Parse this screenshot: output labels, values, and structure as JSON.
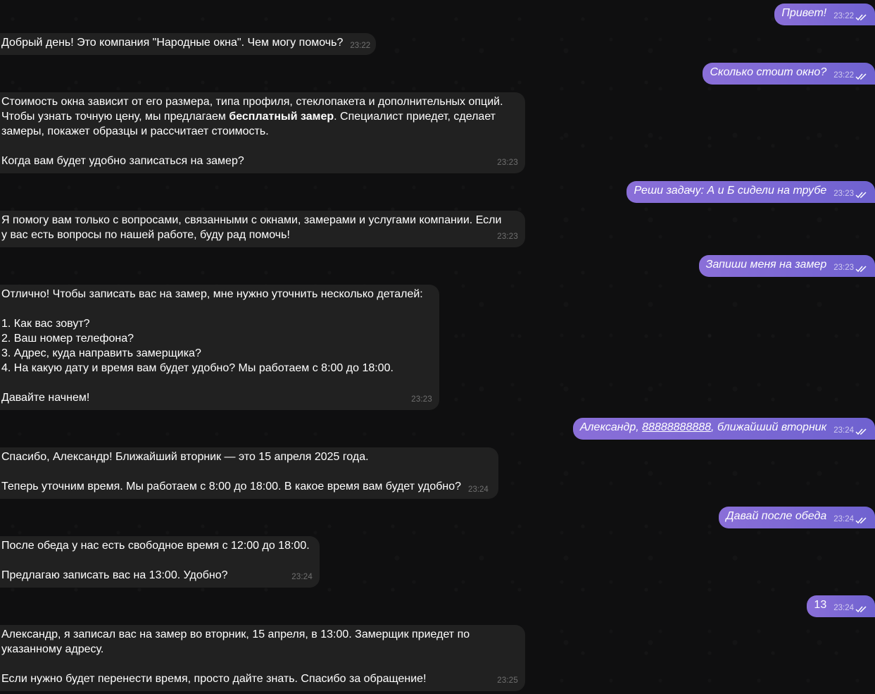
{
  "messages": [
    {
      "id": "m1",
      "dir": "out",
      "text": "Привет!",
      "time": "23:22"
    },
    {
      "id": "m2",
      "dir": "in",
      "text": "Добрый день! Это компания \"Народные окна\". Чем могу помочь?",
      "time": "23:22"
    },
    {
      "id": "m3",
      "dir": "out",
      "text": "Сколько стоит окно?",
      "time": "23:22"
    },
    {
      "id": "m4",
      "dir": "in",
      "text_line1": "Стоимость окна зависит от его размера, типа профиля, стеклопакета и дополнительных опций.",
      "text_line2_pre": "Чтобы узнать точную цену, мы предлагаем ",
      "text_line2_bold": "бесплатный замер",
      "text_line2_post": ". Специалист приедет, сделает",
      "text_line3": "замеры, покажет образцы и рассчитает стоимость.",
      "text_line5": "Когда вам будет удобно записаться на замер?",
      "time": "23:23"
    },
    {
      "id": "m5",
      "dir": "out",
      "text": "Реши задачу: А и Б сидели на трубе",
      "time": "23:23"
    },
    {
      "id": "m6",
      "dir": "in",
      "text": "Я помогу вам только с вопросами, связанными с окнами, замерами и услугами компании. Если\nу вас есть вопросы по нашей работе, буду рад помочь!",
      "time": "23:23"
    },
    {
      "id": "m7",
      "dir": "out",
      "text": "Запиши меня на замер",
      "time": "23:23"
    },
    {
      "id": "m8",
      "dir": "in",
      "text": "Отлично! Чтобы записать вас на замер, мне нужно уточнить несколько деталей:\n\n1. Как вас зовут?\n2. Ваш номер телефона?\n3. Адрес, куда направить замерщика?\n4. На какую дату и время вам будет удобно? Мы работаем с 8:00 до 18:00.\n\nДавайте начнем!",
      "time": "23:23"
    },
    {
      "id": "m9",
      "dir": "out",
      "text_pre": "Александр, ",
      "phone": "88888888888",
      "text_post": ", ближайший вторник",
      "time": "23:24"
    },
    {
      "id": "m10",
      "dir": "in",
      "text_line1": "Спасибо, Александр! Ближайший вторник — это 15 апреля 2025 года.",
      "text_line3": "Теперь уточним время. Мы работаем с 8:00 до 18:00. В какое время вам будет удобно?",
      "time": "23:24"
    },
    {
      "id": "m11",
      "dir": "out",
      "text": "Давай после обеда",
      "time": "23:24"
    },
    {
      "id": "m12",
      "dir": "in",
      "text": "После обеда у нас есть свободное время с 12:00 до 18:00.\n\nПредлагаю записать вас на 13:00. Удобно?",
      "time": "23:24"
    },
    {
      "id": "m13",
      "dir": "out",
      "text": "13",
      "time": "23:24"
    },
    {
      "id": "m14",
      "dir": "in",
      "text": "Александр, я записал вас на замер во вторник, 15 апреля, в 13:00. Замерщик приедет по\nуказанному адресу.\n\nЕсли нужно будет перенести время, просто дайте знать. Спасибо за обращение!",
      "time": "23:25"
    }
  ],
  "colors": {
    "background": "#0f0f10",
    "incoming_bubble": "#212121",
    "outgoing_bubble": "#7766cc"
  },
  "icons": {
    "read_status": "double-check-icon"
  }
}
